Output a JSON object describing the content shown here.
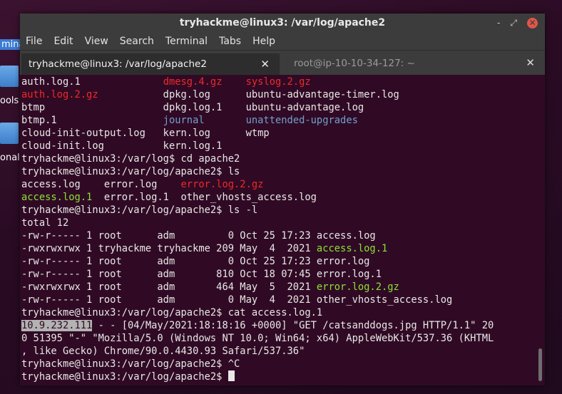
{
  "desktop": {
    "labels": [
      "mina",
      "ools",
      "onal"
    ]
  },
  "window": {
    "title": "tryhackme@linux3: /var/log/apache2",
    "controls": {
      "minimize": "‐",
      "maximize": "⤢",
      "close": "✕"
    }
  },
  "menu": [
    "File",
    "Edit",
    "View",
    "Search",
    "Terminal",
    "Tabs",
    "Help"
  ],
  "tabs": [
    {
      "label": "tryhackme@linux3: /var/log/apache2",
      "active": true,
      "close": "✕"
    },
    {
      "label": "root@ip-10-10-34-127: ~",
      "active": false,
      "close": "✕"
    }
  ],
  "terminal": {
    "lines": [
      [
        {
          "t": "auth.log.1              "
        },
        {
          "t": "dmesg.4.gz",
          "c": "red"
        },
        {
          "t": "    "
        },
        {
          "t": "syslog.2.gz",
          "c": "red"
        }
      ],
      [
        {
          "t": "auth.log.2.gz",
          "c": "red"
        },
        {
          "t": "           dpkg.log      ubuntu-advantage-timer.log"
        }
      ],
      [
        {
          "t": "btmp                    dpkg.log.1    ubuntu-advantage.log"
        }
      ],
      [
        {
          "t": "btmp.1                  "
        },
        {
          "t": "journal",
          "c": "blue"
        },
        {
          "t": "       "
        },
        {
          "t": "unattended-upgrades",
          "c": "blue"
        }
      ],
      [
        {
          "t": "cloud-init-output.log   kern.log      wtmp"
        }
      ],
      [
        {
          "t": "cloud-init.log          kern.log.1"
        }
      ],
      [
        {
          "t": "tryhackme@linux3:/var/log$ cd apache2"
        }
      ],
      [
        {
          "t": "tryhackme@linux3:/var/log/apache2$ ls"
        }
      ],
      [
        {
          "t": "access.log    error.log    "
        },
        {
          "t": "error.log.2.gz",
          "c": "red"
        }
      ],
      [
        {
          "t": "access.log.1",
          "c": "green"
        },
        {
          "t": "  error.log.1  other_vhosts_access.log"
        }
      ],
      [
        {
          "t": "tryhackme@linux3:/var/log/apache2$ ls -l"
        }
      ],
      [
        {
          "t": "total 12"
        }
      ],
      [
        {
          "t": "-rw-r----- 1 root      adm         0 Oct 25 17:23 access.log"
        }
      ],
      [
        {
          "t": "-rwxrwxrwx 1 tryhackme tryhackme 209 May  4  2021 "
        },
        {
          "t": "access.log.1",
          "c": "green"
        }
      ],
      [
        {
          "t": "-rw-r----- 1 root      adm         0 Oct 25 17:23 error.log"
        }
      ],
      [
        {
          "t": "-rw-r----- 1 root      adm       810 Oct 18 07:45 error.log.1"
        }
      ],
      [
        {
          "t": "-rwxrwxrwx 1 root      adm       464 May  5  2021 "
        },
        {
          "t": "error.log.2.gz",
          "c": "green"
        }
      ],
      [
        {
          "t": "-rw-r----- 1 root      adm         0 May  4  2021 other_vhosts_access.log"
        }
      ],
      [
        {
          "t": "tryhackme@linux3:/var/log/apache2$ cat access.log.1"
        }
      ],
      [
        {
          "t": "10.9.232.111",
          "c": "sel"
        },
        {
          "t": " - - [04/May/2021:18:18:16 +0000] \"GET /catsanddogs.jpg HTTP/1.1\" 20"
        }
      ],
      [
        {
          "t": "0 51395 \"-\" \"Mozilla/5.0 (Windows NT 10.0; Win64; x64) AppleWebKit/537.36 (KHTML"
        }
      ],
      [
        {
          "t": ", like Gecko) Chrome/90.0.4430.93 Safari/537.36\""
        }
      ],
      [
        {
          "t": "tryhackme@linux3:/var/log/apache2$ ^C"
        }
      ],
      [
        {
          "t": "tryhackme@linux3:/var/log/apache2$ "
        },
        {
          "t": "",
          "c": "cursor"
        }
      ]
    ]
  },
  "colors": {
    "terminal_bg": "#300a24",
    "red": "#ef2929",
    "blue": "#729fcf",
    "green": "#8ae234"
  }
}
